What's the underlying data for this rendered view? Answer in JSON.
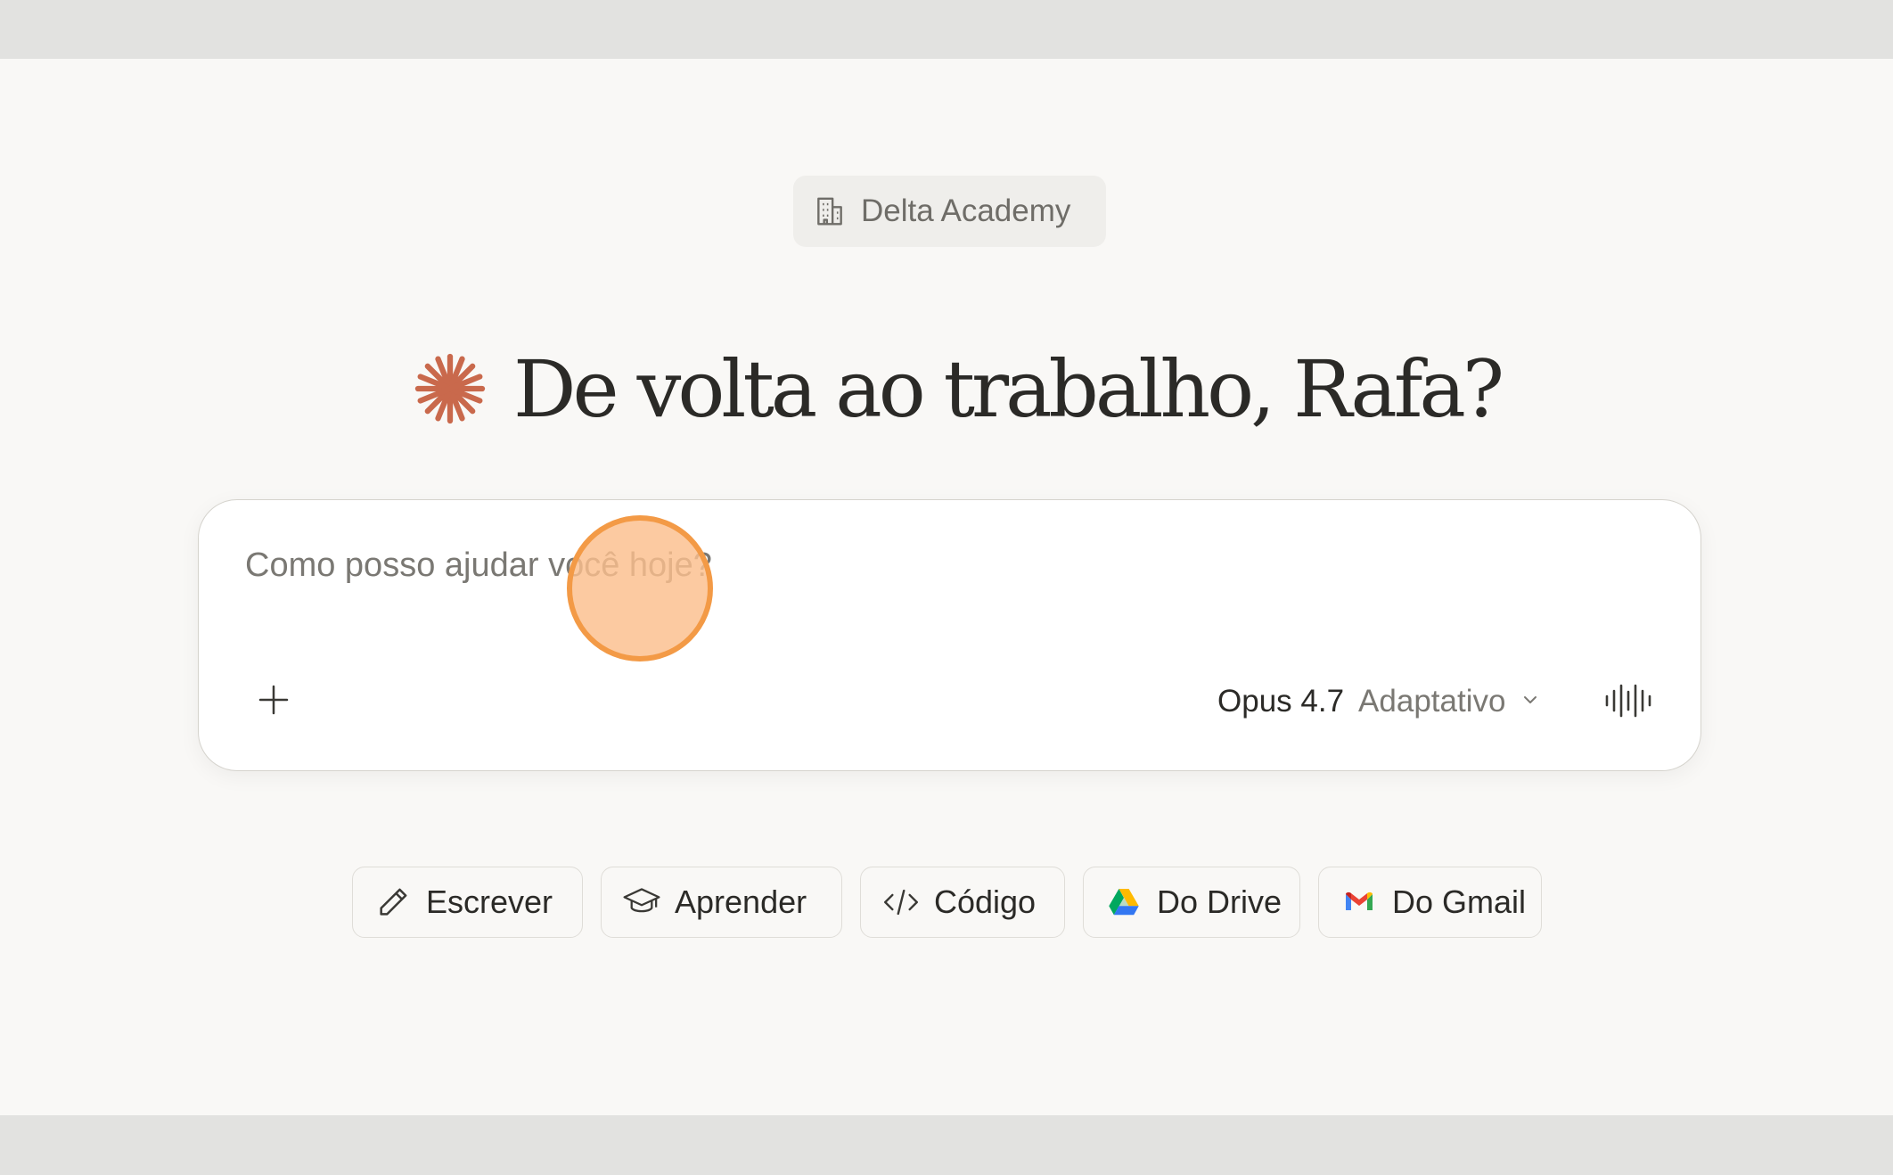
{
  "org": {
    "name": "Delta Academy",
    "icon": "building-icon"
  },
  "greeting": {
    "text": "De volta ao trabalho, Rafa?",
    "icon": "spark-logo-icon"
  },
  "composer": {
    "placeholder": "Como posso ajudar você hoje?",
    "value": "",
    "add_icon": "plus-icon",
    "model": "Opus 4.7",
    "mode": "Adaptativo",
    "dropdown_icon": "chevron-down-icon",
    "voice_icon": "voice-waveform-icon"
  },
  "chips": [
    {
      "label": "Escrever",
      "icon": "pencil-icon"
    },
    {
      "label": "Aprender",
      "icon": "graduation-cap-icon"
    },
    {
      "label": "Código",
      "icon": "code-icon"
    },
    {
      "label": "Do Drive",
      "icon": "google-drive-icon"
    },
    {
      "label": "Do Gmail",
      "icon": "gmail-icon"
    }
  ],
  "colors": {
    "accent": "#d97757",
    "page_background": "#f9f8f6",
    "cursor_highlight": "#f39a46"
  }
}
